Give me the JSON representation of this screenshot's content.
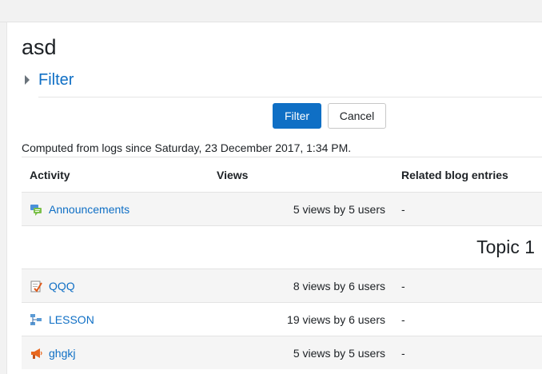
{
  "page": {
    "title": "asd",
    "filter_toggle_label": "Filter",
    "filter_button_label": "Filter",
    "cancel_button_label": "Cancel",
    "computed_note": "Computed from logs since Saturday, 23 December 2017, 1:34 PM."
  },
  "table": {
    "headers": [
      "Activity",
      "Views",
      "Related blog entries"
    ],
    "rows": [
      {
        "icon": "forum-icon",
        "name": "Announcements",
        "views": "5 views by 5 users",
        "blog": "-"
      },
      {
        "section": "Topic 1"
      },
      {
        "icon": "assignment-icon",
        "name": "QQQ",
        "views": "8 views by 6 users",
        "blog": "-"
      },
      {
        "icon": "lesson-icon",
        "name": "LESSON",
        "views": "19 views by 6 users",
        "blog": "-"
      },
      {
        "icon": "feedback-megaphone-icon",
        "name": "ghgkj",
        "views": "5 views by 5 users",
        "blog": "-"
      }
    ]
  },
  "colors": {
    "link": "#0f6fc5",
    "primary_button": "#0f6fc5",
    "stripe": "#f5f5f5"
  }
}
